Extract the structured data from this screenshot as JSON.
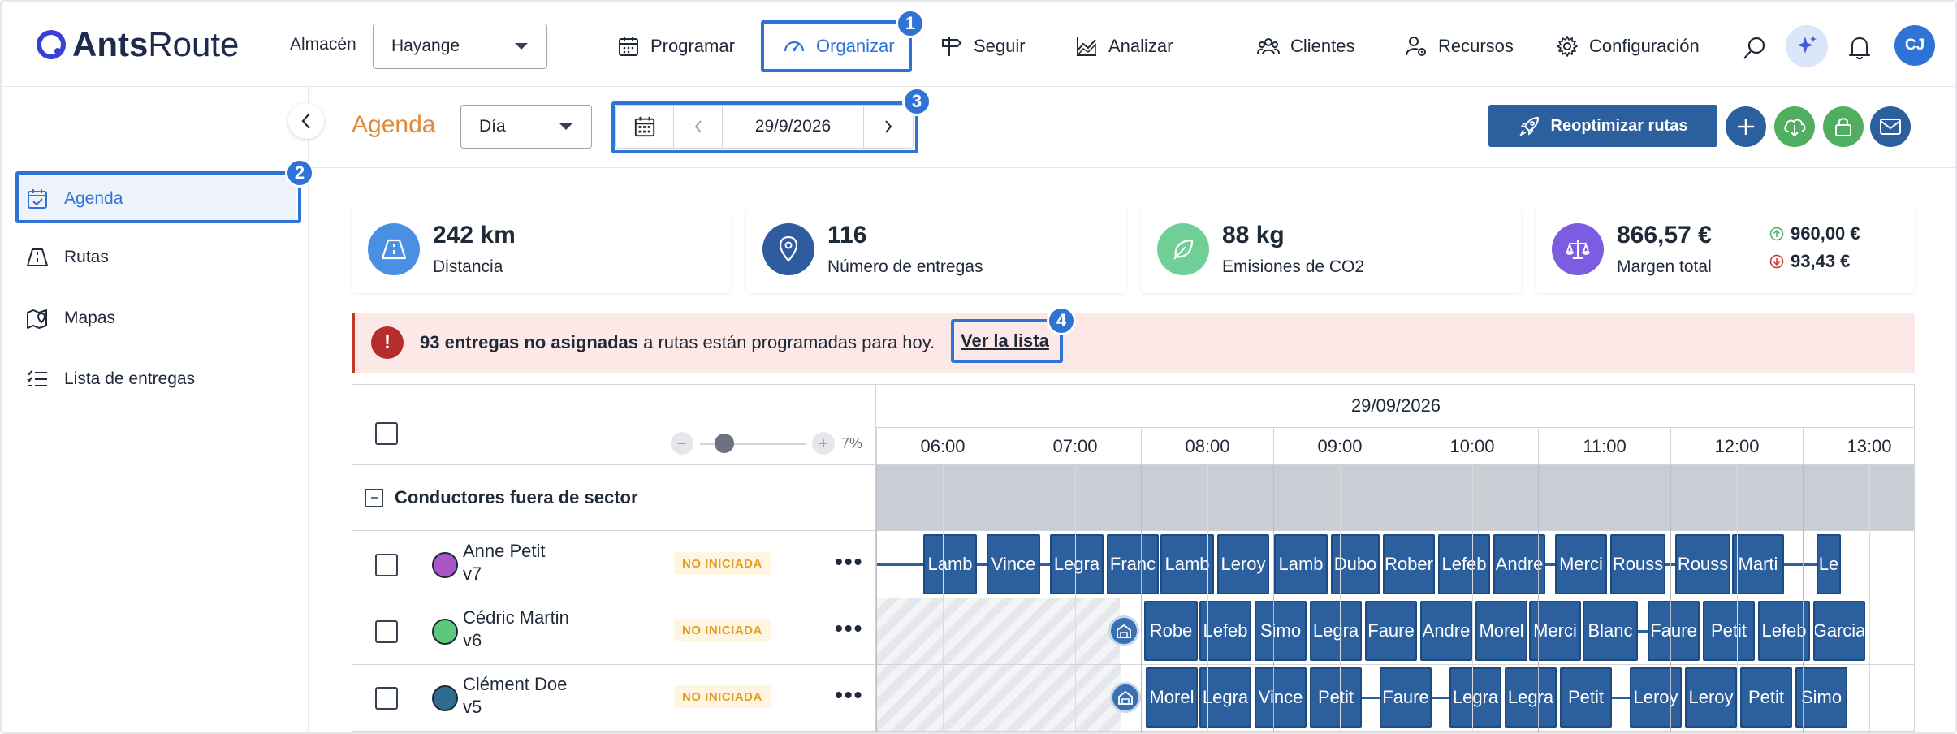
{
  "app": {
    "logo_bold": "Ants",
    "logo_regular": "Route"
  },
  "topbar": {
    "warehouse_label": "Almacén",
    "warehouse_value": "Hayange",
    "nav": [
      {
        "label": "Programar",
        "icon": "calendar-icon"
      },
      {
        "label": "Organizar",
        "icon": "speedometer-icon"
      },
      {
        "label": "Seguir",
        "icon": "signpost-icon"
      },
      {
        "label": "Analizar",
        "icon": "chart-icon"
      },
      {
        "label": "Clientes",
        "icon": "users-icon"
      },
      {
        "label": "Recursos",
        "icon": "user-gear-icon"
      },
      {
        "label": "Configuración",
        "icon": "gear-icon"
      }
    ],
    "avatar": "CJ"
  },
  "badges": {
    "b1": "1",
    "b2": "2",
    "b3": "3",
    "b4": "4"
  },
  "sidebar": {
    "items": [
      {
        "label": "Agenda",
        "icon": "calendar-check-icon"
      },
      {
        "label": "Rutas",
        "icon": "road-icon"
      },
      {
        "label": "Mapas",
        "icon": "map-pin-icon"
      },
      {
        "label": "Lista de entregas",
        "icon": "list-icon"
      }
    ]
  },
  "agenda": {
    "title": "Agenda",
    "view_value": "Día",
    "date_value": "29/9/2026",
    "reoptimize_label": "Reoptimizar rutas"
  },
  "stats": [
    {
      "value": "242 km",
      "label": "Distancia",
      "icon": "road-icon",
      "color": "#4a90e2"
    },
    {
      "value": "116",
      "label": "Número de entregas",
      "icon": "location-pin-icon",
      "color": "#2e5c9e"
    },
    {
      "value": "88 kg",
      "label": "Emisiones de CO2",
      "icon": "leaf-icon",
      "color": "#6fcf97"
    },
    {
      "value": "866,57 €",
      "label": "Margen total",
      "icon": "scale-icon",
      "color": "#7c5ce0"
    }
  ],
  "margin_breakdown": {
    "up": "960,00 €",
    "down": "93,43 €"
  },
  "alert": {
    "bold": "93 entregas no asignadas",
    "text": " a rutas están programadas para hoy.",
    "link": "Ver la lista"
  },
  "timeline": {
    "date_header": "29/09/2026",
    "zoom_value": "7%",
    "hours": [
      "06:00",
      "07:00",
      "08:00",
      "09:00",
      "10:00",
      "11:00",
      "12:00",
      "13:00"
    ],
    "group_label": "Conductores fuera de sector",
    "drivers": [
      {
        "name": "Anne Petit",
        "vehicle": "v7",
        "color": "#a855c7",
        "status": "NO INICIADA",
        "tasks": [
          "Lamb",
          "Vince",
          "Legra",
          "Franc",
          "Lamb",
          "Leroy",
          "Lamb",
          "Dubo",
          "Rober",
          "Lefeb",
          "Andre",
          "Merci",
          "Rouss",
          "Rouss",
          "Marti",
          "Le"
        ]
      },
      {
        "name": "Cédric Martin",
        "vehicle": "v6",
        "color": "#5cc87a",
        "status": "NO INICIADA",
        "tasks": [
          "Robe",
          "Lefeb",
          "Simo",
          "Legra",
          "Faure",
          "Andre",
          "Morel",
          "Merci",
          "Blanc",
          "Faure",
          "Petit",
          "Lefeb",
          "Garcia"
        ]
      },
      {
        "name": "Clément Doe",
        "vehicle": "v5",
        "color": "#2f6b8f",
        "status": "NO INICIADA",
        "tasks": [
          "Morel",
          "Legra",
          "Vince",
          "Petit",
          "Faure",
          "Legra",
          "Legra",
          "Petit",
          "Leroy",
          "Leroy",
          "Petit",
          "Simo"
        ]
      }
    ]
  }
}
